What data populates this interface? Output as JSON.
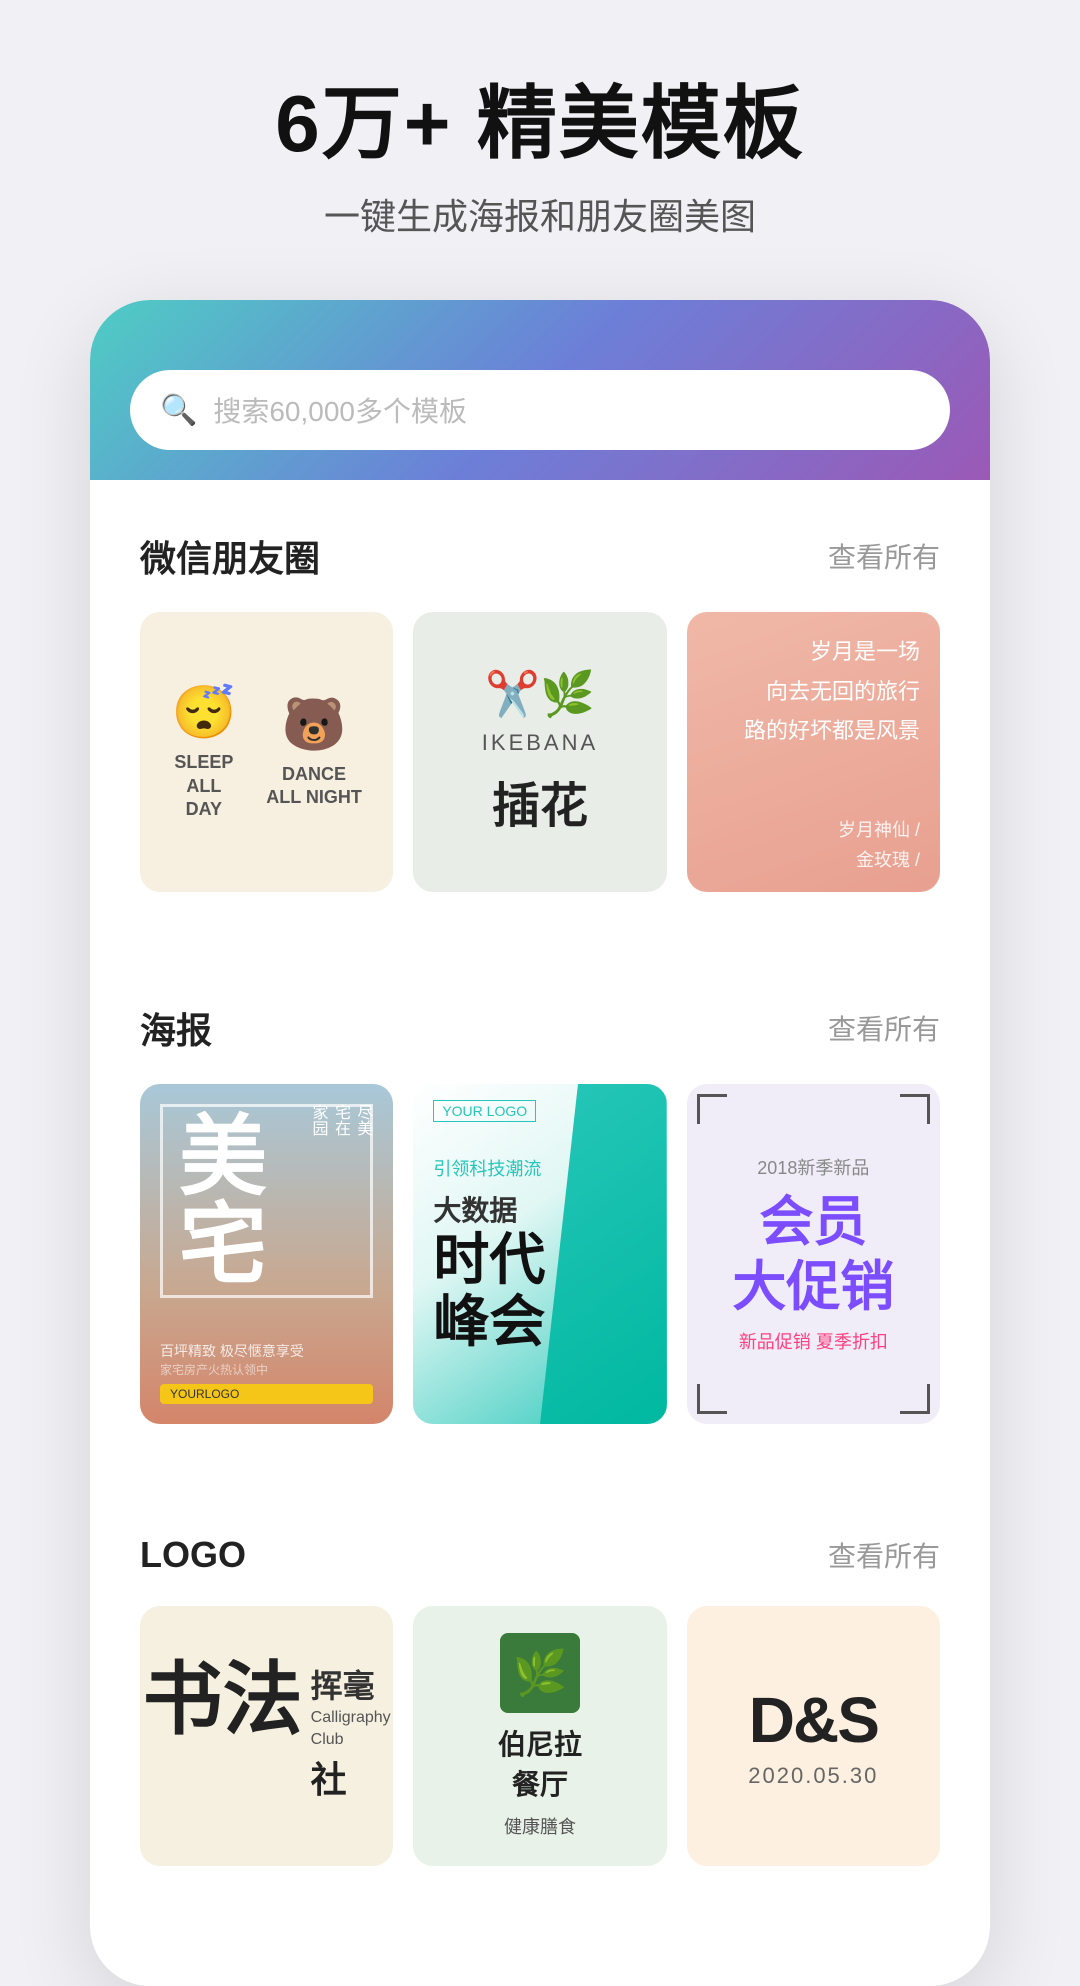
{
  "hero": {
    "title": "6万+ 精美模板",
    "subtitle": "一键生成海报和朋友圈美图"
  },
  "search": {
    "placeholder": "搜索60,000多个模板"
  },
  "sections": {
    "wechat": {
      "title": "微信朋友圈",
      "viewall": "查看所有"
    },
    "poster": {
      "title": "海报",
      "viewall": "查看所有"
    },
    "logo": {
      "title": "LOGO",
      "viewall": "查看所有"
    }
  },
  "wechat_cards": {
    "card1": {
      "emoji1": "😴",
      "emoji2": "🐻",
      "text1_line1": "SLEEP",
      "text1_line2": "ALL",
      "text1_line3": "DAY",
      "text2_line1": "DANCE",
      "text2_line2": "ALL NIGHT"
    },
    "card2": {
      "en": "IKEBANA",
      "cn": "插花"
    },
    "card3": {
      "poem": "岁月是一场\n向去无回的旅行\n路的好坏都是风景",
      "sig1": "岁月神仙 /",
      "sig2": "金玫瑰 /"
    }
  },
  "poster_cards": {
    "card1": {
      "title": "美宅",
      "side": "尽美宅在家园",
      "bottom": "百坪精致 极尽惬意享受",
      "logo": "YOURLOGO"
    },
    "card2": {
      "logo": "YOUR LOGO",
      "subtitle": "引领科技潮流",
      "title_l1": "时代",
      "title_l2": "峰会",
      "bigword": "大数据"
    },
    "card3": {
      "year": "2018新季新品",
      "title_l1": "会员",
      "title_l2": "大促销",
      "sub": "新品促销 夏季折扣"
    }
  },
  "logo_cards": {
    "card1": {
      "cn_big": "书法",
      "cn_brush": "挥毫",
      "en_line1": "Calligraphy",
      "en_line2": "Club",
      "cn_small": "社"
    },
    "card2": {
      "icon": "🌿",
      "name_l1": "伯尼拉",
      "name_l2": "餐厅",
      "sub": "健康膳食"
    },
    "card3": {
      "main": "D&S",
      "date": "2020.05.30"
    }
  }
}
